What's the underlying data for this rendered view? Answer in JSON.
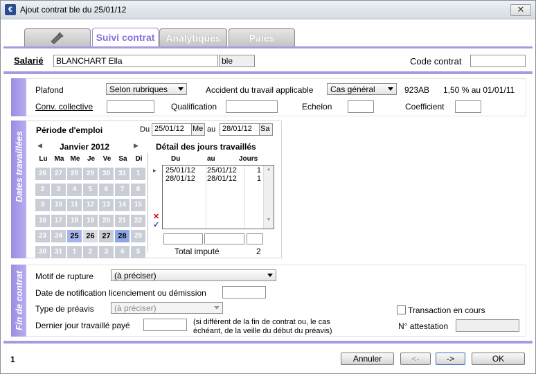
{
  "window": {
    "title": "Ajout contrat ble du 25/01/12",
    "close_label": "✕"
  },
  "tabs": [
    {
      "label": ""
    },
    {
      "label": "Suivi contrat"
    },
    {
      "label": "Analytiques"
    },
    {
      "label": "Paies"
    }
  ],
  "header": {
    "salarie_label": "Salarié",
    "salarie_value": "BLANCHART Ella",
    "salarie_code": "ble",
    "code_contrat_label": "Code contrat",
    "code_contrat_value": ""
  },
  "general": {
    "plafond_label": "Plafond",
    "plafond_value": "Selon rubriques",
    "accident_label": "Accident du travail applicable",
    "accident_value": "Cas général",
    "accident_code": "923AB",
    "accident_rate": "1,50 % au 01/01/11",
    "conv_label": "Conv. collective",
    "conv_value": "",
    "qualification_label": "Qualification",
    "qualification_value": "",
    "echelon_label": "Echelon",
    "echelon_value": "",
    "coefficient_label": "Coefficient",
    "coefficient_value": ""
  },
  "dates": {
    "section_label": "Dates travaillées",
    "periode_label": "Période d'emploi",
    "du_label": "Du",
    "du_value": "25/01/12",
    "du_day": "Me",
    "au_label": "au",
    "au_value": "28/01/12",
    "au_day": "Sa",
    "calendar": {
      "month": "Janvier 2012",
      "prev": "◀",
      "next": "▶",
      "weekdays": [
        "Lu",
        "Ma",
        "Me",
        "Je",
        "Ve",
        "Sa",
        "Di"
      ],
      "weeks": [
        [
          "26",
          "27",
          "28",
          "29",
          "30",
          "31",
          "1"
        ],
        [
          "2",
          "3",
          "4",
          "5",
          "6",
          "7",
          "8"
        ],
        [
          "9",
          "10",
          "11",
          "12",
          "13",
          "14",
          "15"
        ],
        [
          "16",
          "17",
          "18",
          "19",
          "20",
          "21",
          "22"
        ],
        [
          "23",
          "24",
          "25",
          "26",
          "27",
          "28",
          "29"
        ],
        [
          "30",
          "31",
          "1",
          "2",
          "3",
          "4",
          "5"
        ]
      ]
    },
    "detail_title": "Détail des jours travaillés",
    "detail_headers": [
      "Du",
      "au",
      "Jours"
    ],
    "detail_rows": [
      {
        "du": "25/01/12",
        "au": "25/01/12",
        "jours": "1"
      },
      {
        "du": "28/01/12",
        "au": "28/01/12",
        "jours": "1"
      }
    ],
    "total_label": "Total imputé",
    "total_value": "2"
  },
  "fin": {
    "section_label": "Fin de contrat",
    "motif_label": "Motif de rupture",
    "motif_value": "(à préciser)",
    "notif_label": "Date de notification licenciement ou démission",
    "notif_value": "",
    "preavis_label": "Type de préavis",
    "preavis_value": "(à préciser)",
    "transaction_label": "Transaction en cours",
    "dernier_label": "Dernier jour travaillé payé",
    "dernier_value": "",
    "dernier_note": "(si différent de la fin de contrat ou, le cas échéant, de la veille du début du préavis)",
    "attestation_label": "N° attestation",
    "attestation_value": ""
  },
  "footer": {
    "page_number": "1",
    "annuler": "Annuler",
    "prev": "<-",
    "next": "->",
    "ok": "OK"
  }
}
